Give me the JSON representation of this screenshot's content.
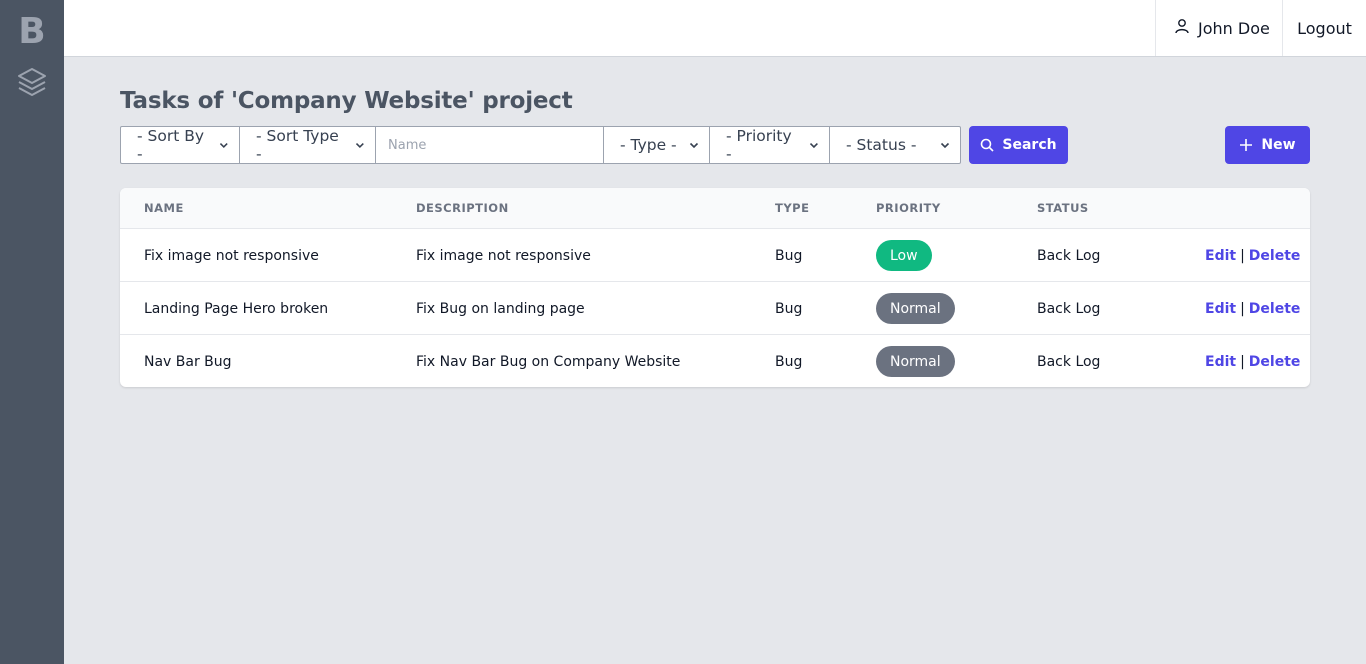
{
  "sidebar": {
    "logo": "B",
    "items": [
      {
        "icon": "layers-icon"
      }
    ]
  },
  "topbar": {
    "user_icon": "user-icon",
    "user_name": "John Doe",
    "logout_label": "Logout"
  },
  "page": {
    "title": "Tasks of 'Company Website' project"
  },
  "filters": {
    "sort_by": "- Sort By -",
    "sort_type": "- Sort Type -",
    "name_placeholder": "Name",
    "type": "- Type -",
    "priority": "- Priority -",
    "status": "- Status -",
    "search_label": "Search",
    "new_label": "New"
  },
  "table": {
    "columns": [
      "NAME",
      "DESCRIPTION",
      "TYPE",
      "PRIORITY",
      "STATUS"
    ],
    "edit_label": "Edit",
    "separator": "|",
    "delete_label": "Delete",
    "rows": [
      {
        "name": "Fix image not responsive",
        "description": "Fix image not responsive",
        "type": "Bug",
        "priority": "Low",
        "status": "Back Log"
      },
      {
        "name": "Landing Page Hero broken",
        "description": "Fix Bug on landing page",
        "type": "Bug",
        "priority": "Normal",
        "status": "Back Log"
      },
      {
        "name": "Nav Bar Bug",
        "description": "Fix Nav Bar Bug on Company Website",
        "type": "Bug",
        "priority": "Normal",
        "status": "Back Log"
      }
    ]
  },
  "colors": {
    "accent": "#4f46e5",
    "sidebar": "#4b5563",
    "priority_low": "#10b981",
    "priority_normal": "#6b7280"
  }
}
